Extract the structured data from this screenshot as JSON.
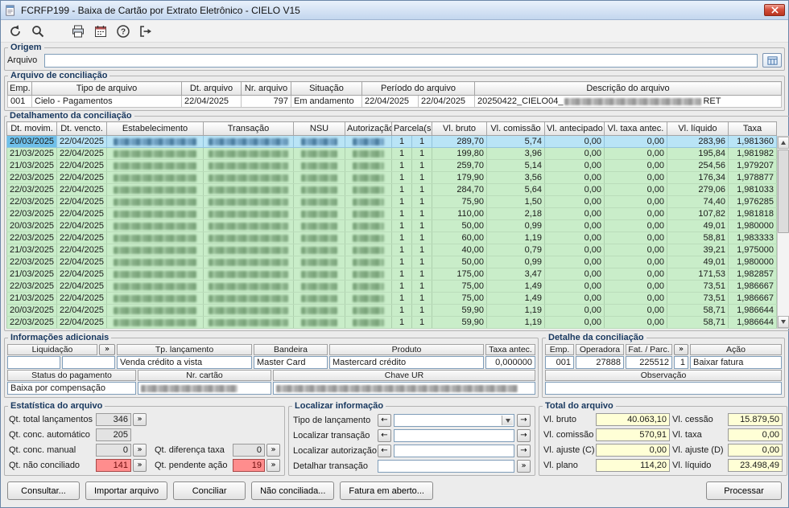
{
  "window": {
    "title": "FCRFP199 - Baixa de Cartão por Extrato Eletrônico - CIELO V15"
  },
  "ui": {
    "more": "»",
    "prev": "←",
    "next": "→"
  },
  "origem": {
    "title": "Origem",
    "arquivo_label": "Arquivo",
    "arquivo_value": ""
  },
  "arquivo": {
    "title": "Arquivo de conciliação",
    "headers": [
      "Emp.",
      "Tipo de arquivo",
      "Dt. arquivo",
      "Nr. arquivo",
      "Situação",
      "Período do arquivo",
      "Descrição do arquivo"
    ],
    "row": {
      "emp": "001",
      "tipo": "Cielo - Pagamentos",
      "dt_arquivo": "22/04/2025",
      "nr_arquivo": "797",
      "situacao": "Em andamento",
      "periodo_de": "22/04/2025",
      "periodo_ate": "22/04/2025",
      "descricao_prefix": "20250422_CIELO04_",
      "descricao_suffix": "RET"
    }
  },
  "detalhamento": {
    "title": "Detalhamento da conciliação",
    "headers": [
      "Dt. movim.",
      "Dt. vencto.",
      "Estabelecimento",
      "Transação",
      "NSU",
      "Autorização",
      "Parcela(s)",
      "Vl. bruto",
      "Vl. comissão",
      "Vl. antecipado",
      "Vl. taxa antec.",
      "Vl. líquido",
      "Taxa"
    ],
    "rows": [
      {
        "dt_movim": "20/03/2025",
        "dt_vencto": "22/04/2025",
        "parc1": "1",
        "parc2": "1",
        "bruto": "289,70",
        "comissao": "5,74",
        "antecipado": "0,00",
        "taxa_antec": "0,00",
        "liquido": "283,96",
        "taxa": "1,981360",
        "selected": true
      },
      {
        "dt_movim": "21/03/2025",
        "dt_vencto": "22/04/2025",
        "parc1": "1",
        "parc2": "1",
        "bruto": "199,80",
        "comissao": "3,96",
        "antecipado": "0,00",
        "taxa_antec": "0,00",
        "liquido": "195,84",
        "taxa": "1,981982"
      },
      {
        "dt_movim": "21/03/2025",
        "dt_vencto": "22/04/2025",
        "parc1": "1",
        "parc2": "1",
        "bruto": "259,70",
        "comissao": "5,14",
        "antecipado": "0,00",
        "taxa_antec": "0,00",
        "liquido": "254,56",
        "taxa": "1,979207"
      },
      {
        "dt_movim": "22/03/2025",
        "dt_vencto": "22/04/2025",
        "parc1": "1",
        "parc2": "1",
        "bruto": "179,90",
        "comissao": "3,56",
        "antecipado": "0,00",
        "taxa_antec": "0,00",
        "liquido": "176,34",
        "taxa": "1,978877"
      },
      {
        "dt_movim": "22/03/2025",
        "dt_vencto": "22/04/2025",
        "parc1": "1",
        "parc2": "1",
        "bruto": "284,70",
        "comissao": "5,64",
        "antecipado": "0,00",
        "taxa_antec": "0,00",
        "liquido": "279,06",
        "taxa": "1,981033"
      },
      {
        "dt_movim": "22/03/2025",
        "dt_vencto": "22/04/2025",
        "parc1": "1",
        "parc2": "1",
        "bruto": "75,90",
        "comissao": "1,50",
        "antecipado": "0,00",
        "taxa_antec": "0,00",
        "liquido": "74,40",
        "taxa": "1,976285"
      },
      {
        "dt_movim": "22/03/2025",
        "dt_vencto": "22/04/2025",
        "parc1": "1",
        "parc2": "1",
        "bruto": "110,00",
        "comissao": "2,18",
        "antecipado": "0,00",
        "taxa_antec": "0,00",
        "liquido": "107,82",
        "taxa": "1,981818"
      },
      {
        "dt_movim": "20/03/2025",
        "dt_vencto": "22/04/2025",
        "parc1": "1",
        "parc2": "1",
        "bruto": "50,00",
        "comissao": "0,99",
        "antecipado": "0,00",
        "taxa_antec": "0,00",
        "liquido": "49,01",
        "taxa": "1,980000"
      },
      {
        "dt_movim": "22/03/2025",
        "dt_vencto": "22/04/2025",
        "parc1": "1",
        "parc2": "1",
        "bruto": "60,00",
        "comissao": "1,19",
        "antecipado": "0,00",
        "taxa_antec": "0,00",
        "liquido": "58,81",
        "taxa": "1,983333"
      },
      {
        "dt_movim": "21/03/2025",
        "dt_vencto": "22/04/2025",
        "parc1": "1",
        "parc2": "1",
        "bruto": "40,00",
        "comissao": "0,79",
        "antecipado": "0,00",
        "taxa_antec": "0,00",
        "liquido": "39,21",
        "taxa": "1,975000"
      },
      {
        "dt_movim": "22/03/2025",
        "dt_vencto": "22/04/2025",
        "parc1": "1",
        "parc2": "1",
        "bruto": "50,00",
        "comissao": "0,99",
        "antecipado": "0,00",
        "taxa_antec": "0,00",
        "liquido": "49,01",
        "taxa": "1,980000"
      },
      {
        "dt_movim": "21/03/2025",
        "dt_vencto": "22/04/2025",
        "parc1": "1",
        "parc2": "1",
        "bruto": "175,00",
        "comissao": "3,47",
        "antecipado": "0,00",
        "taxa_antec": "0,00",
        "liquido": "171,53",
        "taxa": "1,982857"
      },
      {
        "dt_movim": "22/03/2025",
        "dt_vencto": "22/04/2025",
        "parc1": "1",
        "parc2": "1",
        "bruto": "75,00",
        "comissao": "1,49",
        "antecipado": "0,00",
        "taxa_antec": "0,00",
        "liquido": "73,51",
        "taxa": "1,986667"
      },
      {
        "dt_movim": "21/03/2025",
        "dt_vencto": "22/04/2025",
        "parc1": "1",
        "parc2": "1",
        "bruto": "75,00",
        "comissao": "1,49",
        "antecipado": "0,00",
        "taxa_antec": "0,00",
        "liquido": "73,51",
        "taxa": "1,986667"
      },
      {
        "dt_movim": "20/03/2025",
        "dt_vencto": "22/04/2025",
        "parc1": "1",
        "parc2": "1",
        "bruto": "59,90",
        "comissao": "1,19",
        "antecipado": "0,00",
        "taxa_antec": "0,00",
        "liquido": "58,71",
        "taxa": "1,986644"
      },
      {
        "dt_movim": "22/03/2025",
        "dt_vencto": "22/04/2025",
        "parc1": "1",
        "parc2": "1",
        "bruto": "59,90",
        "comissao": "1,19",
        "antecipado": "0,00",
        "taxa_antec": "0,00",
        "liquido": "58,71",
        "taxa": "1,986644"
      }
    ]
  },
  "info": {
    "title": "Informações adicionais",
    "liquidacao_label": "Liquidação",
    "liquidacao_1": "",
    "liquidacao_2": "",
    "tp_label": "Tp. lançamento",
    "tp_value": "Venda crédito a vista",
    "bandeira_label": "Bandeira",
    "bandeira_value": "Master Card",
    "produto_label": "Produto",
    "produto_value": "Mastercard crédito",
    "taxa_label": "Taxa antec.",
    "taxa_value": "0,000000",
    "status_label": "Status do pagamento",
    "status_value": "Baixa por compensação",
    "cartao_label": "Nr. cartão",
    "chave_label": "Chave UR"
  },
  "detalhe": {
    "title": "Detalhe da conciliação",
    "h_emp": "Emp.",
    "h_operadora": "Operadora",
    "h_fat": "Fat. / Parc.",
    "h_acao": "Ação",
    "emp": "001",
    "operadora": "27888",
    "fat": "225512",
    "parc": "1",
    "acao": "Baixar fatura",
    "obs_label": "Observação",
    "obs_value": ""
  },
  "estatistica": {
    "title": "Estatística do arquivo",
    "total_label": "Qt. total lançamentos",
    "total_value": "346",
    "auto_label": "Qt. conc. automático",
    "auto_value": "205",
    "manual_label": "Qt. conc. manual",
    "manual_value": "0",
    "dif_label": "Qt. diferença taxa",
    "dif_value": "0",
    "naoconc_label": "Qt. não conciliado",
    "naoconc_value": "141",
    "pend_label": "Qt. pendente ação",
    "pend_value": "19"
  },
  "localizar": {
    "title": "Localizar informação",
    "tipo_label": "Tipo de lançamento",
    "tipo_value": "",
    "transacao_label": "Localizar transação",
    "transacao_value": "",
    "autorizacao_label": "Localizar autorização",
    "autorizacao_value": "",
    "detalhar_label": "Detalhar transação",
    "detalhar_value": ""
  },
  "total": {
    "title": "Total do arquivo",
    "fields": [
      {
        "label": "Vl. bruto",
        "value": "40.063,10"
      },
      {
        "label": "Vl. cessão",
        "value": "15.879,50"
      },
      {
        "label": "Vl. comissão",
        "value": "570,91"
      },
      {
        "label": "Vl. taxa",
        "value": "0,00"
      },
      {
        "label": "Vl. ajuste (C)",
        "value": "0,00"
      },
      {
        "label": "Vl. ajuste (D)",
        "value": "0,00"
      },
      {
        "label": "Vl. plano",
        "value": "114,20"
      },
      {
        "label": "Vl. líquido",
        "value": "23.498,49"
      }
    ]
  },
  "buttons": {
    "consultar": "Consultar...",
    "importar": "Importar arquivo",
    "conciliar": "Conciliar",
    "nao_conciliada": "Não conciliada...",
    "fatura": "Fatura em aberto...",
    "processar": "Processar"
  }
}
